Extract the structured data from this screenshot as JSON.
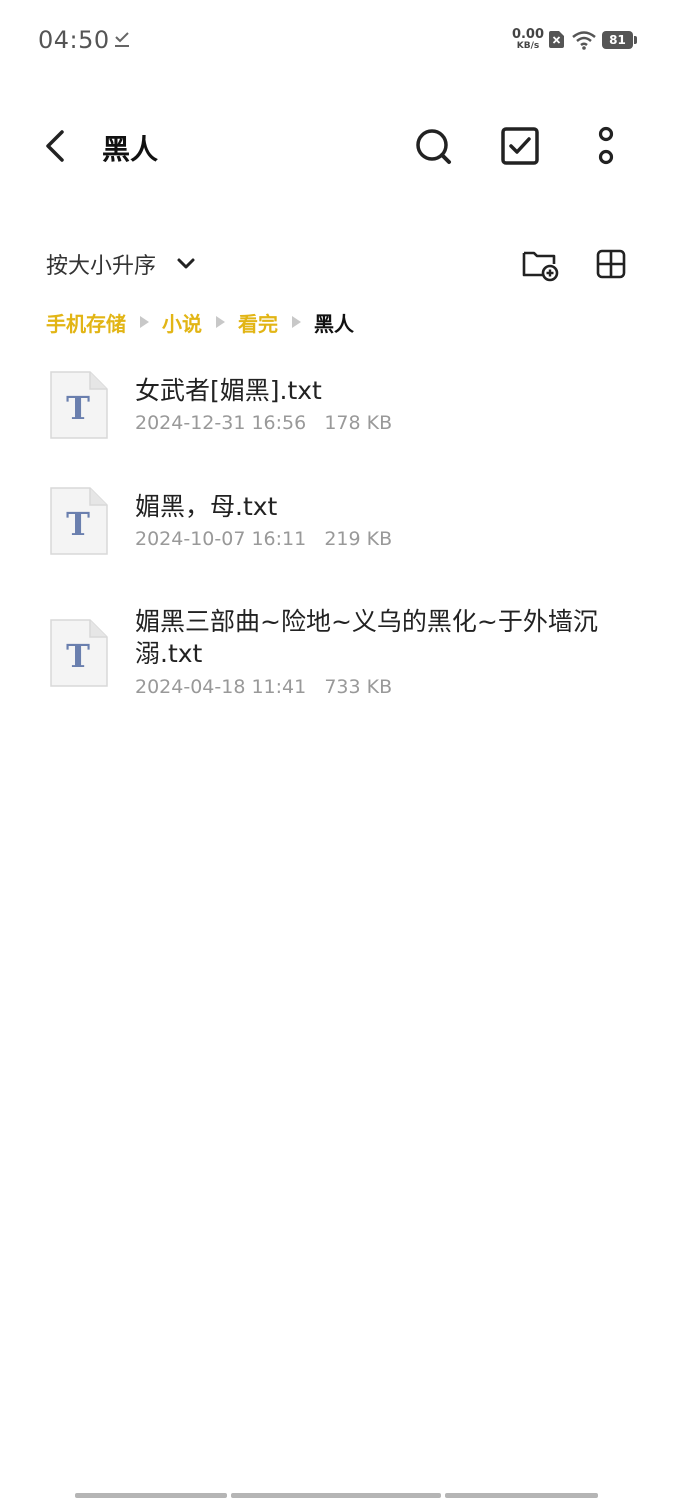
{
  "status_bar": {
    "time": "04:50",
    "net_speed_value": "0.00",
    "net_speed_unit": "KB/s",
    "battery_level": "81",
    "icons": [
      "download-done-icon",
      "sim-icon",
      "wifi-icon",
      "battery-icon"
    ]
  },
  "header": {
    "title": "黑人",
    "actions": [
      "back-icon",
      "search-icon",
      "multi-select-icon",
      "more-icon"
    ]
  },
  "toolbar": {
    "sort_label": "按大小升序",
    "actions": [
      "new-folder-icon",
      "grid-view-icon"
    ]
  },
  "breadcrumb": [
    {
      "label": "手机存储"
    },
    {
      "label": "小说"
    },
    {
      "label": "看完"
    },
    {
      "label": "黑人"
    }
  ],
  "files": [
    {
      "name": "女武者[媚黑].txt",
      "date": "2024-12-31 16:56",
      "size": "178 KB",
      "icon": "txt-file-icon"
    },
    {
      "name": "媚黑，母.txt",
      "date": "2024-10-07 16:11",
      "size": "219 KB",
      "icon": "txt-file-icon"
    },
    {
      "name": "媚黑三部曲~险地~义乌的黑化~于外墙沉溺.txt",
      "date": "2024-04-18 11:41",
      "size": "733 KB",
      "icon": "txt-file-icon"
    }
  ],
  "colors": {
    "breadcrumb_accent": "#e2b515",
    "file_icon_letter": "#6a7fae",
    "meta_text": "#999999"
  }
}
